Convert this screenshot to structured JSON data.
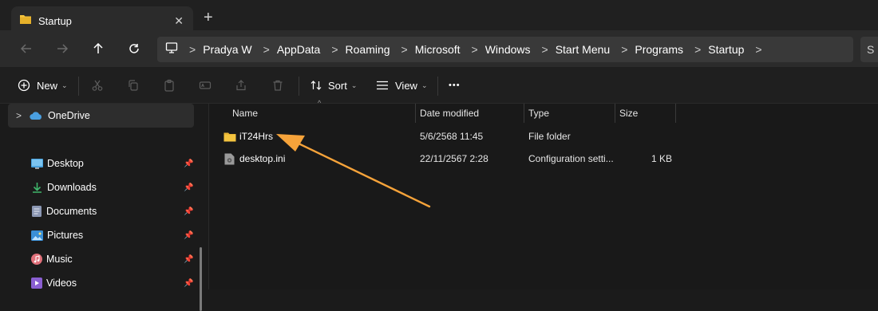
{
  "window": {
    "tab_title": "Startup",
    "tab_close_glyph": "✕",
    "new_tab_glyph": "+"
  },
  "nav": {
    "back_icon": "arrow-left",
    "forward_icon": "arrow-right",
    "up_icon": "arrow-up",
    "refresh_icon": "refresh",
    "breadcrumbs": [
      "Pradya W",
      "AppData",
      "Roaming",
      "Microsoft",
      "Windows",
      "Start Menu",
      "Programs",
      "Startup"
    ],
    "search_partial": "S"
  },
  "commandbar": {
    "new_label": "New",
    "sort_label": "Sort",
    "view_label": "View",
    "more_glyph": "•••"
  },
  "sidebar": {
    "onedrive_label": "OneDrive",
    "items": [
      {
        "label": "Desktop",
        "icon": "desktop-icon",
        "pinned": true
      },
      {
        "label": "Downloads",
        "icon": "downloads-icon",
        "pinned": true
      },
      {
        "label": "Documents",
        "icon": "documents-icon",
        "pinned": true
      },
      {
        "label": "Pictures",
        "icon": "pictures-icon",
        "pinned": true
      },
      {
        "label": "Music",
        "icon": "music-icon",
        "pinned": true
      },
      {
        "label": "Videos",
        "icon": "videos-icon",
        "pinned": true
      }
    ]
  },
  "table": {
    "columns": {
      "name": "Name",
      "date": "Date modified",
      "type": "Type",
      "size": "Size"
    },
    "rows": [
      {
        "name": "iT24Hrs",
        "date": "5/6/2568 11:45",
        "type": "File folder",
        "size": "",
        "icon": "folder-icon"
      },
      {
        "name": "desktop.ini",
        "date": "22/11/2567 2:28",
        "type": "Configuration setti...",
        "size": "1 KB",
        "icon": "settings-file-icon"
      }
    ]
  },
  "colors": {
    "accent_arrow": "#f6a33a",
    "folder_yellow": "#f4c43f",
    "onedrive_blue": "#4a9fe0"
  }
}
